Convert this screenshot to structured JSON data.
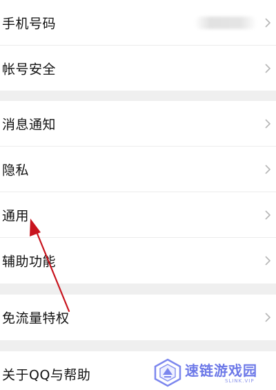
{
  "settings": {
    "groups": [
      {
        "items": [
          {
            "label": "手机号码",
            "has_value": true
          },
          {
            "label": "帐号安全",
            "has_value": false
          }
        ]
      },
      {
        "items": [
          {
            "label": "消息通知"
          },
          {
            "label": "隐私"
          },
          {
            "label": "通用"
          },
          {
            "label": "辅助功能"
          }
        ]
      },
      {
        "items": [
          {
            "label": "免流量特权"
          }
        ]
      },
      {
        "items": [
          {
            "label": "关于QQ与帮助"
          }
        ]
      }
    ],
    "chevron_icon": "chevron-right-icon"
  },
  "annotation": {
    "arrow_color": "#c8141e",
    "arrow_icon": "red-arrow-icon"
  },
  "watermark": {
    "text": "速链游戏园",
    "subtext": "SLINK.VIP",
    "color": "#6d79e8"
  }
}
